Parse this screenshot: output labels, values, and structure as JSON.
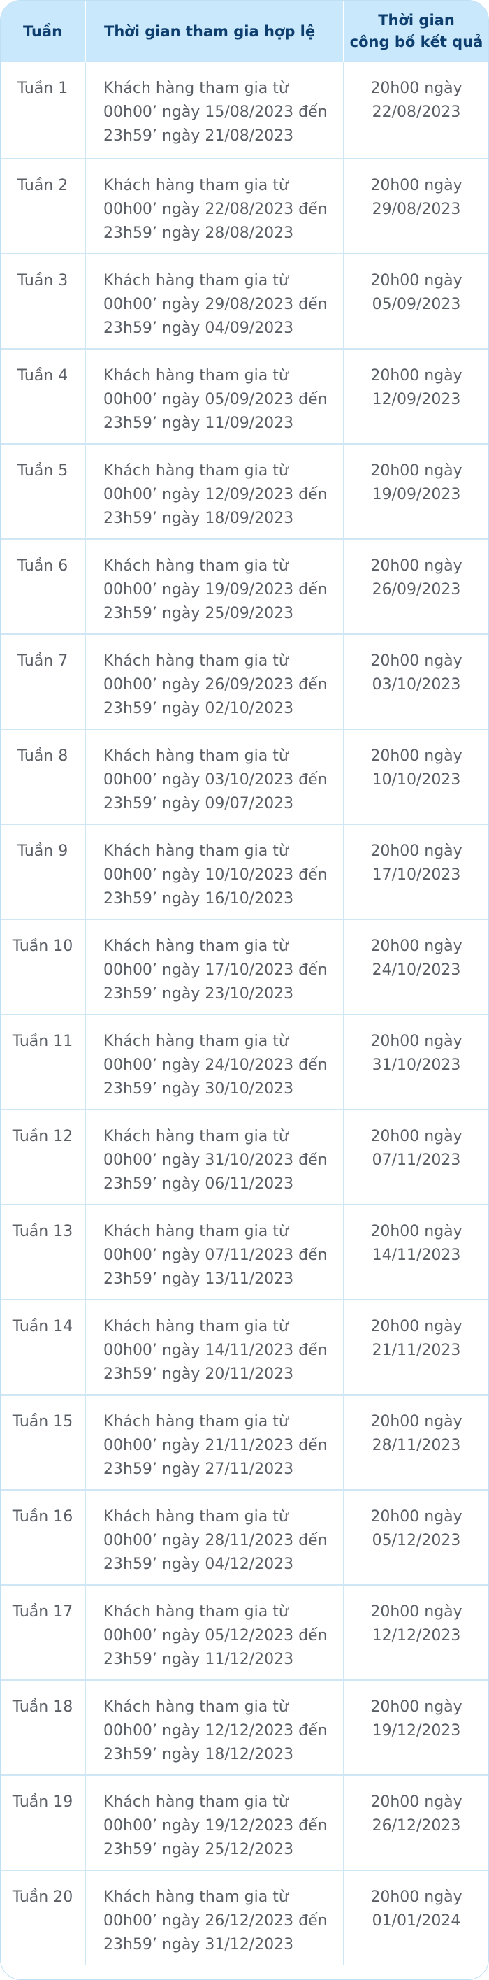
{
  "header": {
    "week": "Tuần",
    "period": "Thời gian tham gia hợp lệ",
    "announce_line1": "Thời gian",
    "announce_line2": "công bố kết quả"
  },
  "rows": [
    {
      "week": "Tuần 1",
      "p1": "Khách hàng tham gia từ",
      "p2": "00h00’ ngày 15/08/2023 đến",
      "p3": "23h59’ ngày 21/08/2023",
      "a1": "20h00 ngày",
      "a2": "22/08/2023"
    },
    {
      "week": "Tuần 2",
      "p1": "Khách hàng tham gia từ",
      "p2": "00h00’ ngày 22/08/2023 đến",
      "p3": "23h59’ ngày 28/08/2023",
      "a1": "20h00 ngày",
      "a2": "29/08/2023"
    },
    {
      "week": "Tuần 3",
      "p1": "Khách hàng tham gia từ",
      "p2": "00h00’ ngày 29/08/2023 đến",
      "p3": "23h59’ ngày 04/09/2023",
      "a1": "20h00 ngày",
      "a2": "05/09/2023"
    },
    {
      "week": "Tuần 4",
      "p1": "Khách hàng tham gia từ",
      "p2": "00h00’ ngày 05/09/2023 đến",
      "p3": "23h59’ ngày 11/09/2023",
      "a1": "20h00 ngày",
      "a2": "12/09/2023"
    },
    {
      "week": "Tuần 5",
      "p1": "Khách hàng tham gia từ",
      "p2": "00h00’ ngày 12/09/2023 đến",
      "p3": "23h59’ ngày 18/09/2023",
      "a1": "20h00 ngày",
      "a2": "19/09/2023"
    },
    {
      "week": "Tuần 6",
      "p1": "Khách hàng tham gia từ",
      "p2": "00h00’ ngày 19/09/2023 đến",
      "p3": "23h59’ ngày 25/09/2023",
      "a1": "20h00 ngày",
      "a2": "26/09/2023"
    },
    {
      "week": "Tuần 7",
      "p1": "Khách hàng tham gia từ",
      "p2": "00h00’ ngày 26/09/2023 đến",
      "p3": "23h59’ ngày 02/10/2023",
      "a1": "20h00 ngày",
      "a2": "03/10/2023"
    },
    {
      "week": "Tuần 8",
      "p1": "Khách hàng tham gia từ",
      "p2": "00h00’ ngày 03/10/2023 đến",
      "p3": "23h59’ ngày 09/07/2023",
      "a1": "20h00 ngày",
      "a2": "10/10/2023"
    },
    {
      "week": "Tuần 9",
      "p1": "Khách hàng tham gia từ",
      "p2": "00h00’ ngày 10/10/2023 đến",
      "p3": "23h59’ ngày 16/10/2023",
      "a1": "20h00 ngày",
      "a2": "17/10/2023"
    },
    {
      "week": "Tuần 10",
      "p1": "Khách hàng tham gia từ",
      "p2": "00h00’ ngày 17/10/2023 đến",
      "p3": "23h59’ ngày 23/10/2023",
      "a1": "20h00 ngày",
      "a2": "24/10/2023"
    },
    {
      "week": "Tuần 11",
      "p1": "Khách hàng tham gia từ",
      "p2": "00h00’ ngày 24/10/2023 đến",
      "p3": "23h59’ ngày 30/10/2023",
      "a1": "20h00 ngày",
      "a2": "31/10/2023"
    },
    {
      "week": "Tuần 12",
      "p1": "Khách hàng tham gia từ",
      "p2": "00h00’ ngày 31/10/2023 đến",
      "p3": "23h59’ ngày 06/11/2023",
      "a1": "20h00 ngày",
      "a2": "07/11/2023"
    },
    {
      "week": "Tuần 13",
      "p1": "Khách hàng tham gia từ",
      "p2": "00h00’ ngày 07/11/2023 đến",
      "p3": "23h59’ ngày 13/11/2023",
      "a1": "20h00 ngày",
      "a2": "14/11/2023"
    },
    {
      "week": "Tuần 14",
      "p1": "Khách hàng tham gia từ",
      "p2": "00h00’ ngày 14/11/2023 đến",
      "p3": "23h59’ ngày 20/11/2023",
      "a1": "20h00 ngày",
      "a2": "21/11/2023"
    },
    {
      "week": "Tuần 15",
      "p1": "Khách hàng tham gia từ",
      "p2": "00h00’ ngày 21/11/2023 đến",
      "p3": "23h59’ ngày 27/11/2023",
      "a1": "20h00 ngày",
      "a2": "28/11/2023"
    },
    {
      "week": "Tuần 16",
      "p1": "Khách hàng tham gia từ",
      "p2": "00h00’ ngày 28/11/2023 đến",
      "p3": "23h59’ ngày 04/12/2023",
      "a1": "20h00 ngày",
      "a2": "05/12/2023"
    },
    {
      "week": "Tuần 17",
      "p1": "Khách hàng tham gia từ",
      "p2": "00h00’ ngày 05/12/2023 đến",
      "p3": "23h59’ ngày 11/12/2023",
      "a1": "20h00 ngày",
      "a2": "12/12/2023"
    },
    {
      "week": "Tuần 18",
      "p1": "Khách hàng tham gia từ",
      "p2": "00h00’ ngày 12/12/2023 đến",
      "p3": "23h59’ ngày 18/12/2023",
      "a1": "20h00 ngày",
      "a2": "19/12/2023"
    },
    {
      "week": "Tuần 19",
      "p1": "Khách hàng tham gia từ",
      "p2": "00h00’ ngày 19/12/2023 đến",
      "p3": "23h59’ ngày 25/12/2023",
      "a1": "20h00 ngày",
      "a2": "26/12/2023"
    },
    {
      "week": "Tuần 20",
      "p1": "Khách hàng tham gia từ",
      "p2": "00h00’ ngày 26/12/2023 đến",
      "p3": "23h59’ ngày 31/12/2023",
      "a1": "20h00 ngày",
      "a2": "01/01/2024"
    }
  ]
}
